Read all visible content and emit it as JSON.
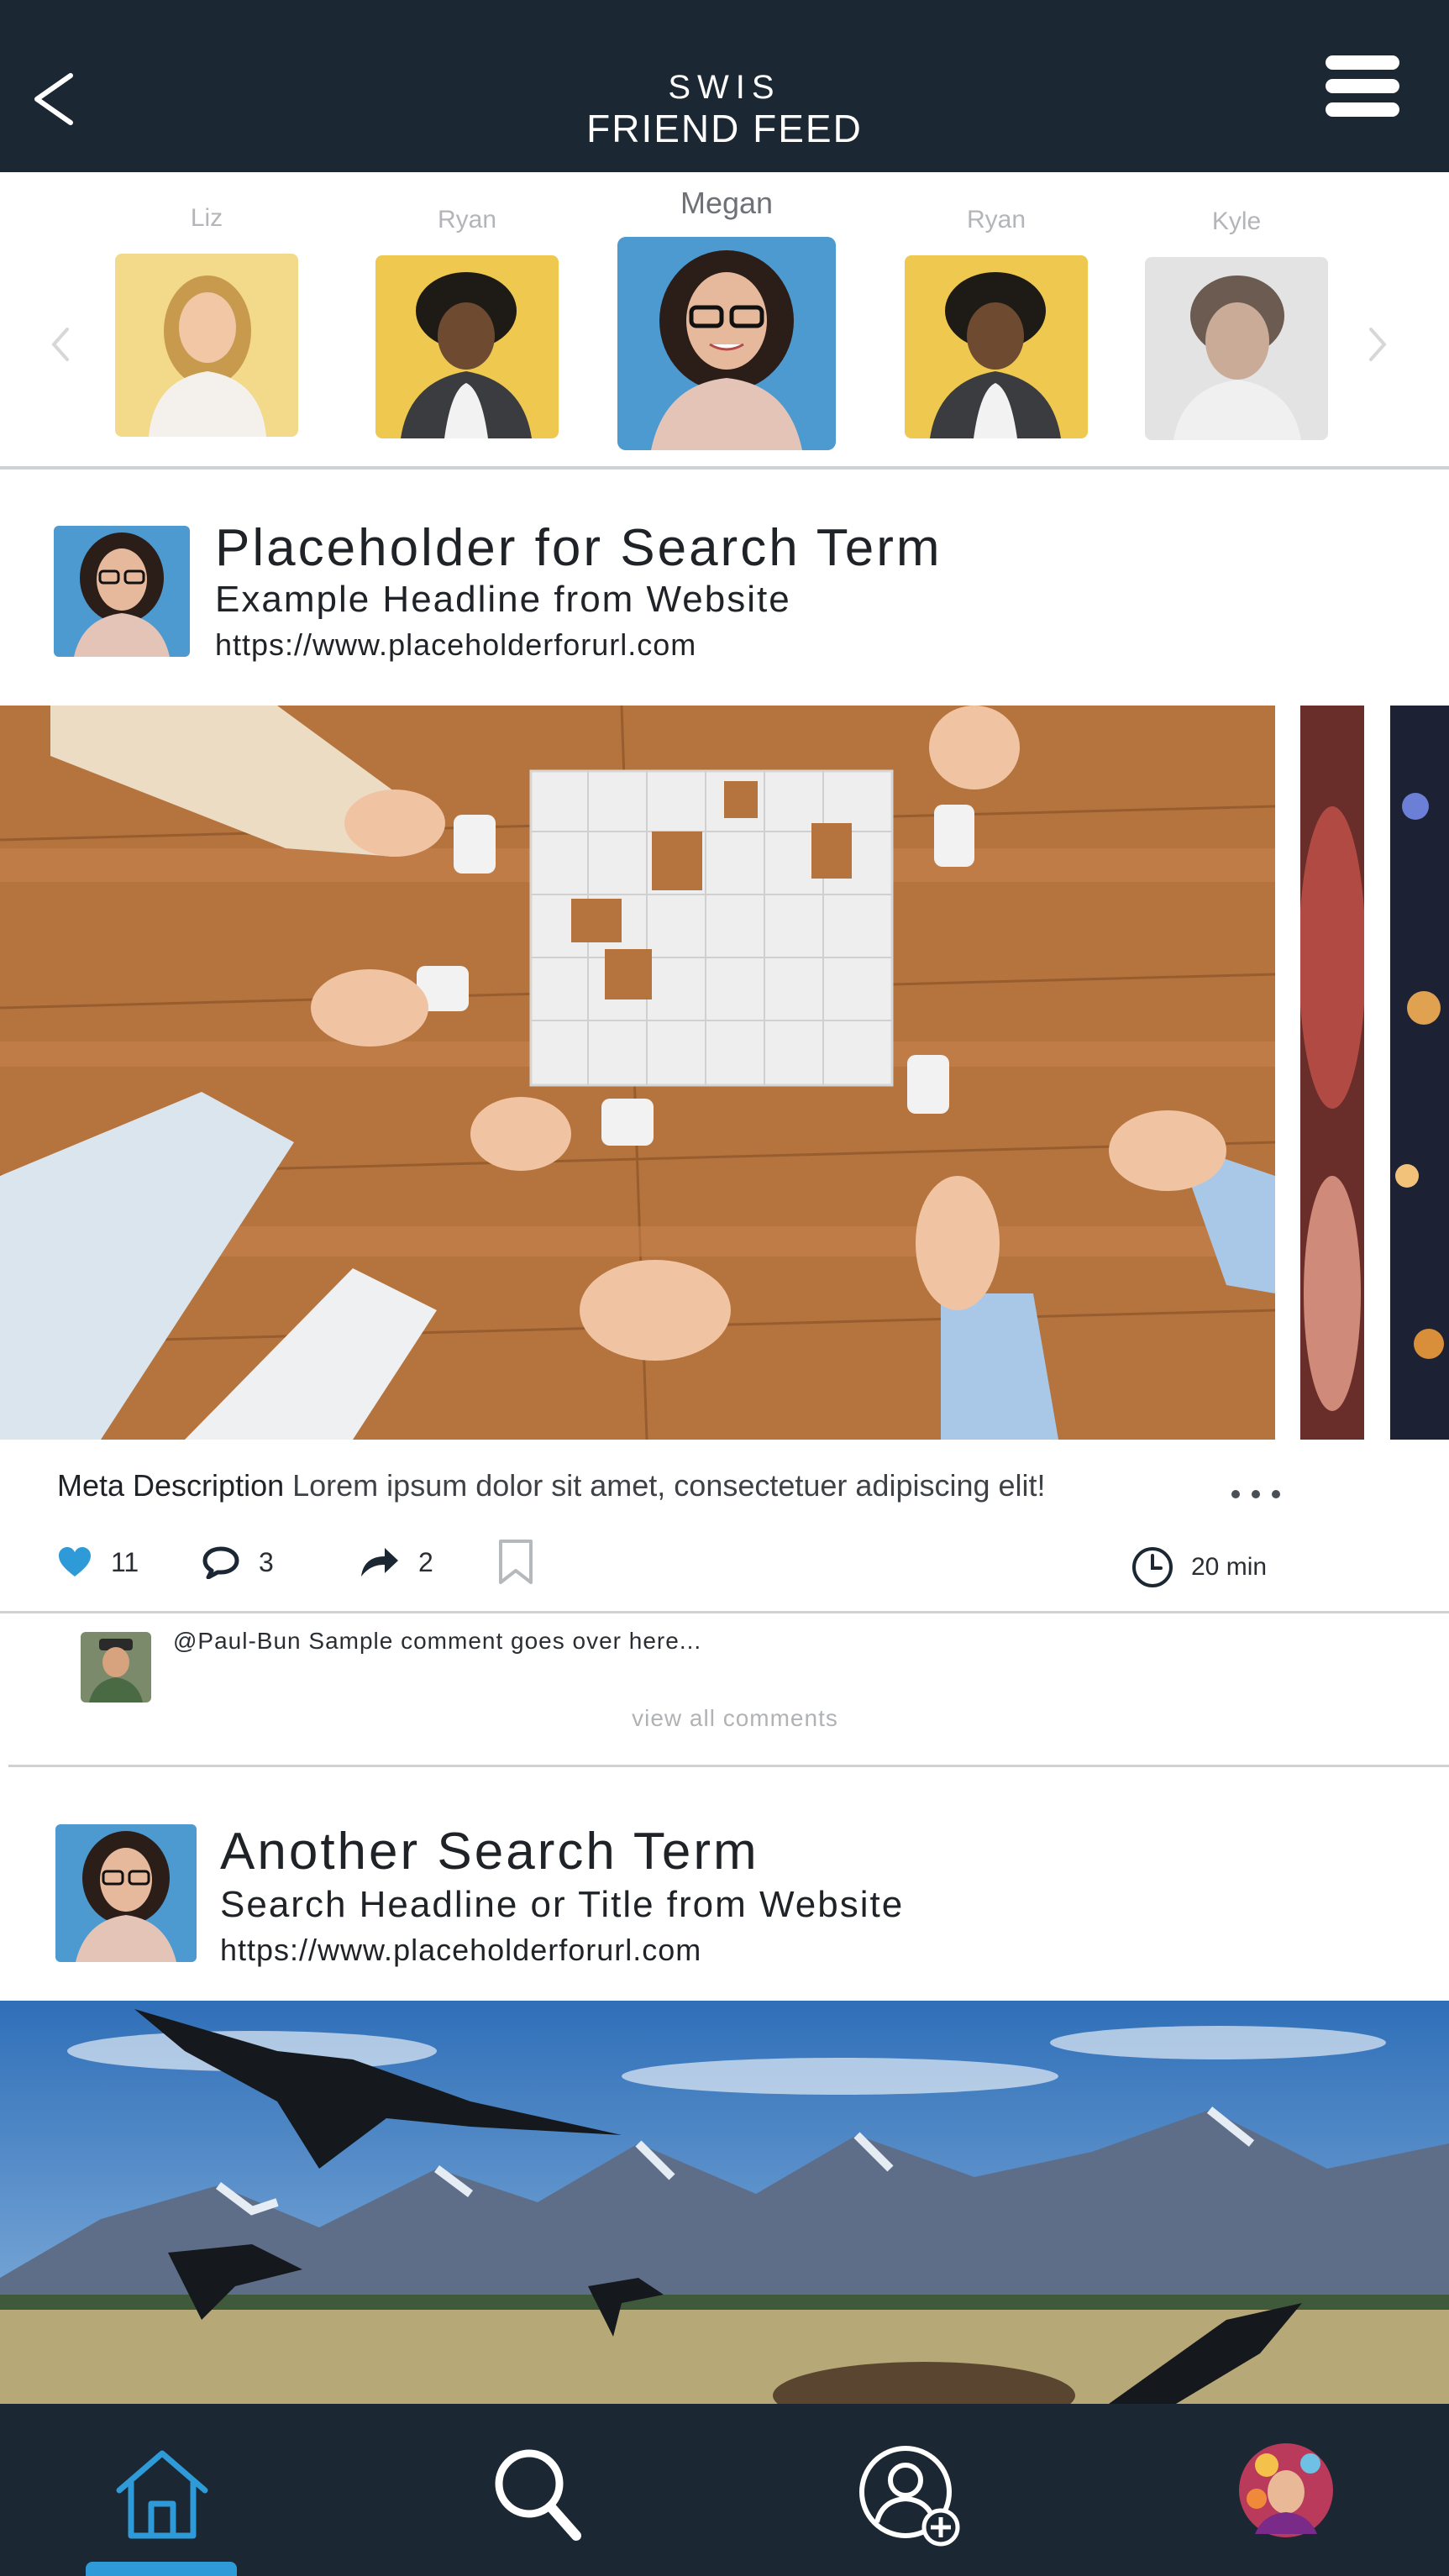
{
  "header": {
    "app_name": "SWIS",
    "title": "FRIEND FEED"
  },
  "friends": {
    "items": [
      {
        "name": "Liz",
        "selected": false
      },
      {
        "name": "Ryan",
        "selected": false
      },
      {
        "name": "Megan",
        "selected": true
      },
      {
        "name": "Ryan",
        "selected": false
      },
      {
        "name": "Kyle",
        "selected": false
      }
    ]
  },
  "posts": [
    {
      "search_term": "Placeholder for Search Term",
      "headline": "Example Headline from Website",
      "url": "https://www.placeholderforurl.com",
      "meta_label": "Meta Description",
      "meta_text": "Lorem ipsum dolor sit amet, consectetuer adipiscing elit!",
      "likes": "11",
      "comments": "3",
      "shares": "2",
      "read_time": "20 min",
      "comment_preview": "@Paul-Bun Sample comment goes over here...",
      "view_all_label": "view all comments"
    },
    {
      "search_term": "Another Search Term",
      "headline": "Search Headline or Title from Website",
      "url": "https://www.placeholderforurl.com"
    }
  ],
  "colors": {
    "header_bg": "#1b2833",
    "accent": "#2f9ad8",
    "divider": "#cfd2d4"
  },
  "bottom_nav": {
    "items": [
      "home-icon",
      "search-icon",
      "add-friend-icon",
      "profile-avatar"
    ],
    "active": "home-icon"
  }
}
